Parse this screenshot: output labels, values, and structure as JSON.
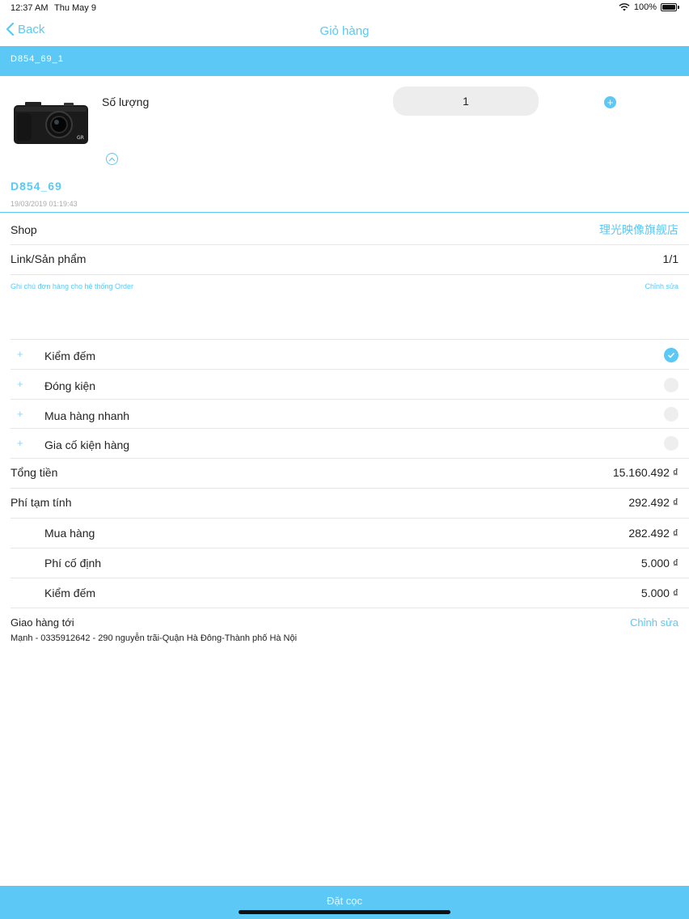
{
  "status_bar": {
    "time": "12:37 AM",
    "date": "Thu May 9",
    "battery": "100%"
  },
  "nav": {
    "back_label": "Back",
    "title": "Giỏ hàng"
  },
  "band": {
    "label": "D854_69_1"
  },
  "product": {
    "quantity_label": "Số lượng",
    "quantity_value": "1",
    "order_code": "D854_69",
    "order_date": "19/03/2019 01:19:43"
  },
  "info": {
    "shop_label": "Shop",
    "shop_value": "理光映像旗舰店",
    "link_label": "Link/Sản phẩm",
    "link_value": "1/1",
    "note_placeholder": "Ghi chú đơn hàng cho hệ thống Order",
    "note_edit": "Chỉnh sửa"
  },
  "services": [
    {
      "label": "Kiểm đếm",
      "checked": true
    },
    {
      "label": "Đóng kiện",
      "checked": false
    },
    {
      "label": "Mua hàng nhanh",
      "checked": false
    },
    {
      "label": "Gia cố kiện hàng",
      "checked": false
    }
  ],
  "totals": {
    "total_label": "Tổng tiền",
    "total_value": "15.160.492 ₫",
    "fee_label": "Phí tạm tính",
    "fee_value": "292.492 ₫",
    "breakdown": [
      {
        "label": "Mua hàng",
        "value": "282.492 ₫"
      },
      {
        "label": "Phí cố định",
        "value": "5.000 ₫"
      },
      {
        "label": "Kiểm đếm",
        "value": "5.000 ₫"
      }
    ]
  },
  "shipping": {
    "title": "Giao hàng tới",
    "edit": "Chỉnh sửa",
    "address": "Mạnh - 0335912642 - 290 nguyễn trãi-Quận Hà Đông-Thành phố Hà Nội"
  },
  "footer": {
    "deposit_button": "Đặt cọc"
  },
  "colors": {
    "accent": "#5bc8f5",
    "divider": "#e6e6e6",
    "radio_off": "#eeeeee"
  }
}
